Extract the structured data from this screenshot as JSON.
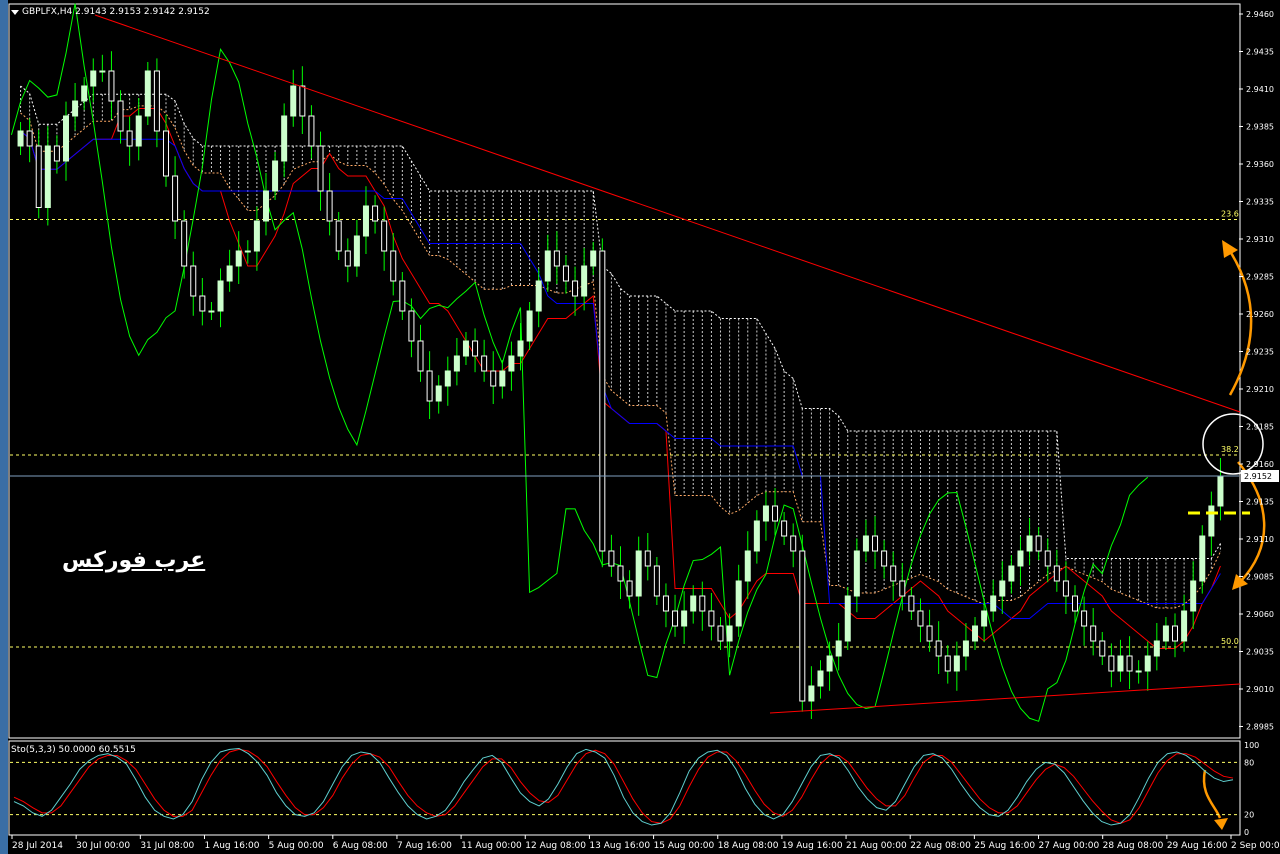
{
  "header": {
    "symbol": "GBPLFX,H4",
    "ohlc": "2.9143 2.9153 2.9142 2.9152"
  },
  "watermark": "عرب فوركس",
  "colors": {
    "background": "#000000",
    "axis": "#ffffff",
    "bull_candle": "#ccffcc",
    "bear_candle": "#ffffff",
    "candle_wick": "#00ff00",
    "tenkan": "#ff0000",
    "kijun": "#0000ff",
    "chikou": "#00ff00",
    "trendline": "#ff0000",
    "fib_level": "#ffff66",
    "current_price_line": "#7f9fbf",
    "annotation": "#ff9900",
    "support_marker": "#ffff00",
    "stoch_main": "#5fcfcf",
    "stoch_signal": "#ff0000"
  },
  "chart_data": {
    "type": "candlestick",
    "timeframe": "H4",
    "price_axis": {
      "ticks": [
        "2.9460",
        "2.9435",
        "2.9410",
        "2.9385",
        "2.9360",
        "2.9335",
        "2.9310",
        "2.9285",
        "2.9260",
        "2.9235",
        "2.9210",
        "2.9185",
        "2.9160",
        "2.9135",
        "2.9110",
        "2.9085",
        "2.9060",
        "2.9035",
        "2.9010",
        "2.8985"
      ],
      "ylim": [
        2.8978,
        2.9466
      ],
      "current_price": "2.9152"
    },
    "time_axis": {
      "ticks": [
        "28 Jul 2014",
        "30 Jul 00:00",
        "31 Jul 08:00",
        "1 Aug 16:00",
        "5 Aug 00:00",
        "6 Aug 08:00",
        "7 Aug 16:00",
        "11 Aug 00:00",
        "12 Aug 08:00",
        "13 Aug 16:00",
        "15 Aug 00:00",
        "18 Aug 08:00",
        "19 Aug 16:00",
        "21 Aug 00:00",
        "22 Aug 08:00",
        "25 Aug 16:00",
        "27 Aug 00:00",
        "28 Aug 08:00",
        "29 Aug 16:00",
        "2 Sep 00:00"
      ]
    },
    "fib_levels": [
      {
        "label": "23.6",
        "price": 2.9323
      },
      {
        "label": "38.2",
        "price": 2.9166
      },
      {
        "label": "50.0",
        "price": 2.9038
      }
    ],
    "support_marker_price": 2.9129,
    "closes": [
      2.9382,
      2.9372,
      2.9331,
      2.9372,
      2.9362,
      2.9392,
      2.9402,
      2.9412,
      2.9422,
      2.9422,
      2.9402,
      2.9382,
      2.9372,
      2.9392,
      2.9422,
      2.9382,
      2.9352,
      2.9322,
      2.9292,
      2.9272,
      2.9262,
      2.9262,
      2.9282,
      2.9292,
      2.9302,
      2.9302,
      2.9322,
      2.9342,
      2.9362,
      2.9392,
      2.9412,
      2.9392,
      2.9372,
      2.9342,
      2.9322,
      2.9302,
      2.9292,
      2.9312,
      2.9332,
      2.9322,
      2.9302,
      2.9282,
      2.9262,
      2.9242,
      2.9222,
      2.9202,
      2.9212,
      2.9222,
      2.9232,
      2.9242,
      2.9232,
      2.9222,
      2.9212,
      2.9222,
      2.9232,
      2.9242,
      2.9262,
      2.9282,
      2.9302,
      2.9292,
      2.9282,
      2.9272,
      2.9292,
      2.9302,
      2.9102,
      2.9092,
      2.9082,
      2.9072,
      2.9102,
      2.9092,
      2.9072,
      2.9062,
      2.9052,
      2.9062,
      2.9072,
      2.9062,
      2.9052,
      2.9042,
      2.9052,
      2.9082,
      2.9102,
      2.9122,
      2.9132,
      2.9122,
      2.9112,
      2.9102,
      2.9002,
      2.9012,
      2.9022,
      2.9032,
      2.9042,
      2.9072,
      2.9102,
      2.9112,
      2.9102,
      2.9092,
      2.9082,
      2.9072,
      2.9062,
      2.9052,
      2.9042,
      2.9032,
      2.9022,
      2.9032,
      2.9042,
      2.9052,
      2.9062,
      2.9072,
      2.9082,
      2.9092,
      2.9102,
      2.9112,
      2.9102,
      2.9092,
      2.9082,
      2.9072,
      2.9062,
      2.9052,
      2.9042,
      2.9032,
      2.9022,
      2.9032,
      2.9022,
      2.9022,
      2.9032,
      2.9042,
      2.9052,
      2.9042,
      2.9062,
      2.9082,
      2.9112,
      2.9132,
      2.9152
    ]
  },
  "stochastic": {
    "label": "Sto(5,3,3) 50.0000 60.5515",
    "axis_ticks": [
      "100",
      "80",
      "20",
      "0"
    ],
    "levels": [
      80,
      20
    ],
    "main": [
      35,
      30,
      22,
      18,
      25,
      40,
      55,
      72,
      82,
      88,
      90,
      86,
      78,
      60,
      40,
      25,
      18,
      15,
      20,
      35,
      60,
      80,
      92,
      95,
      96,
      90,
      80,
      65,
      45,
      30,
      20,
      18,
      22,
      35,
      55,
      75,
      88,
      92,
      90,
      80,
      62,
      45,
      30,
      20,
      15,
      18,
      25,
      40,
      58,
      72,
      85,
      88,
      80,
      62,
      45,
      35,
      30,
      38,
      55,
      75,
      90,
      95,
      92,
      85,
      65,
      40,
      22,
      12,
      8,
      10,
      22,
      45,
      70,
      85,
      92,
      94,
      88,
      72,
      50,
      32,
      20,
      15,
      20,
      35,
      55,
      75,
      88,
      90,
      85,
      70,
      52,
      38,
      28,
      25,
      35,
      55,
      75,
      88,
      90,
      85,
      72,
      55,
      40,
      28,
      20,
      18,
      25,
      40,
      58,
      72,
      80,
      78,
      68,
      52,
      36,
      22,
      12,
      8,
      10,
      20,
      40,
      62,
      80,
      90,
      92,
      88,
      80,
      70,
      62,
      58,
      60
    ],
    "signal": [
      40,
      35,
      28,
      22,
      22,
      30,
      45,
      60,
      75,
      84,
      88,
      88,
      82,
      72,
      55,
      38,
      25,
      18,
      18,
      25,
      45,
      65,
      82,
      92,
      95,
      93,
      86,
      75,
      58,
      42,
      28,
      20,
      20,
      28,
      42,
      62,
      78,
      88,
      90,
      86,
      75,
      58,
      42,
      30,
      22,
      18,
      20,
      30,
      45,
      60,
      75,
      84,
      84,
      74,
      58,
      45,
      36,
      34,
      42,
      60,
      78,
      90,
      94,
      90,
      78,
      58,
      38,
      22,
      12,
      10,
      15,
      30,
      52,
      72,
      86,
      92,
      92,
      82,
      66,
      48,
      32,
      22,
      18,
      25,
      40,
      60,
      78,
      88,
      88,
      80,
      65,
      50,
      38,
      30,
      30,
      42,
      62,
      80,
      88,
      88,
      80,
      66,
      52,
      38,
      28,
      22,
      22,
      30,
      45,
      60,
      72,
      78,
      74,
      64,
      50,
      36,
      24,
      14,
      10,
      14,
      28,
      48,
      68,
      82,
      90,
      90,
      86,
      78,
      70,
      64,
      62
    ]
  }
}
